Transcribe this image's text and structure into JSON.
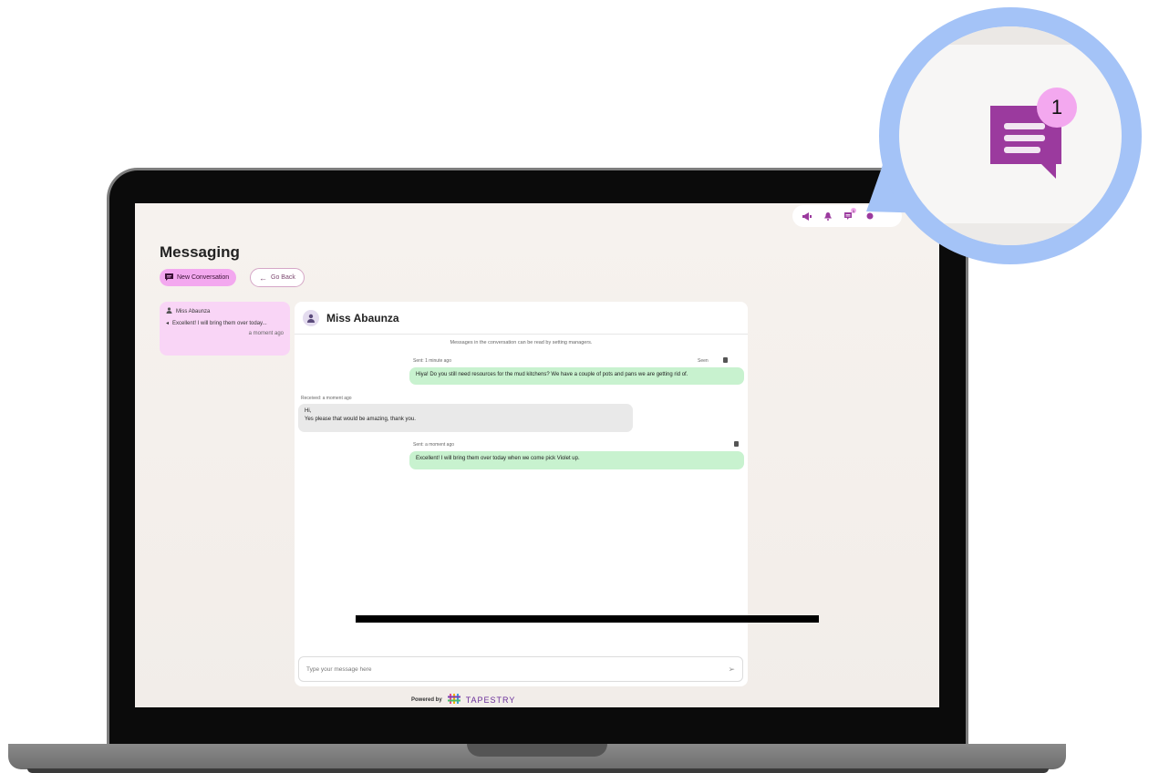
{
  "page": {
    "title": "Messaging",
    "new_conversation_label": "New Conversation",
    "go_back_label": "Go Back"
  },
  "conversation_list": [
    {
      "name": "Miss Abaunza",
      "preview": "Excellent! I will bring them over today...",
      "time": "a moment ago"
    }
  ],
  "chat": {
    "contact_name": "Miss Abaunza",
    "notice": "Messages in the conversation can be read by setting managers.",
    "messages": [
      {
        "direction": "sent",
        "meta": "Sent: 1 minute ago",
        "status": "Seen",
        "lines": [
          "Hiya! Do you still need resources for the mud kitchens? We have a couple of pots and pans we are getting rid of."
        ]
      },
      {
        "direction": "received",
        "meta": "Received: a moment ago",
        "lines": [
          "Hi,",
          "Yes please that would be amazing, thank you."
        ]
      },
      {
        "direction": "sent",
        "meta": "Sent: a moment ago",
        "lines": [
          "Excellent! I will bring them over today when we come pick Violet up."
        ]
      }
    ],
    "input_placeholder": "Type your message here"
  },
  "footer": {
    "powered_by": "Powered by",
    "brand": "TAPESTRY"
  },
  "topbar": {
    "icons": [
      "megaphone-icon",
      "bell-icon",
      "messages-icon",
      "account-icon"
    ],
    "messages_badge": "1"
  },
  "callout": {
    "badge": "1"
  },
  "colors": {
    "accent_pink": "#f3a8ef",
    "icon_purple": "#9b3a9e",
    "sent_bubble": "#c8f2cf",
    "received_bubble": "#e9e9e9",
    "callout_ring": "#a4c3f7"
  }
}
